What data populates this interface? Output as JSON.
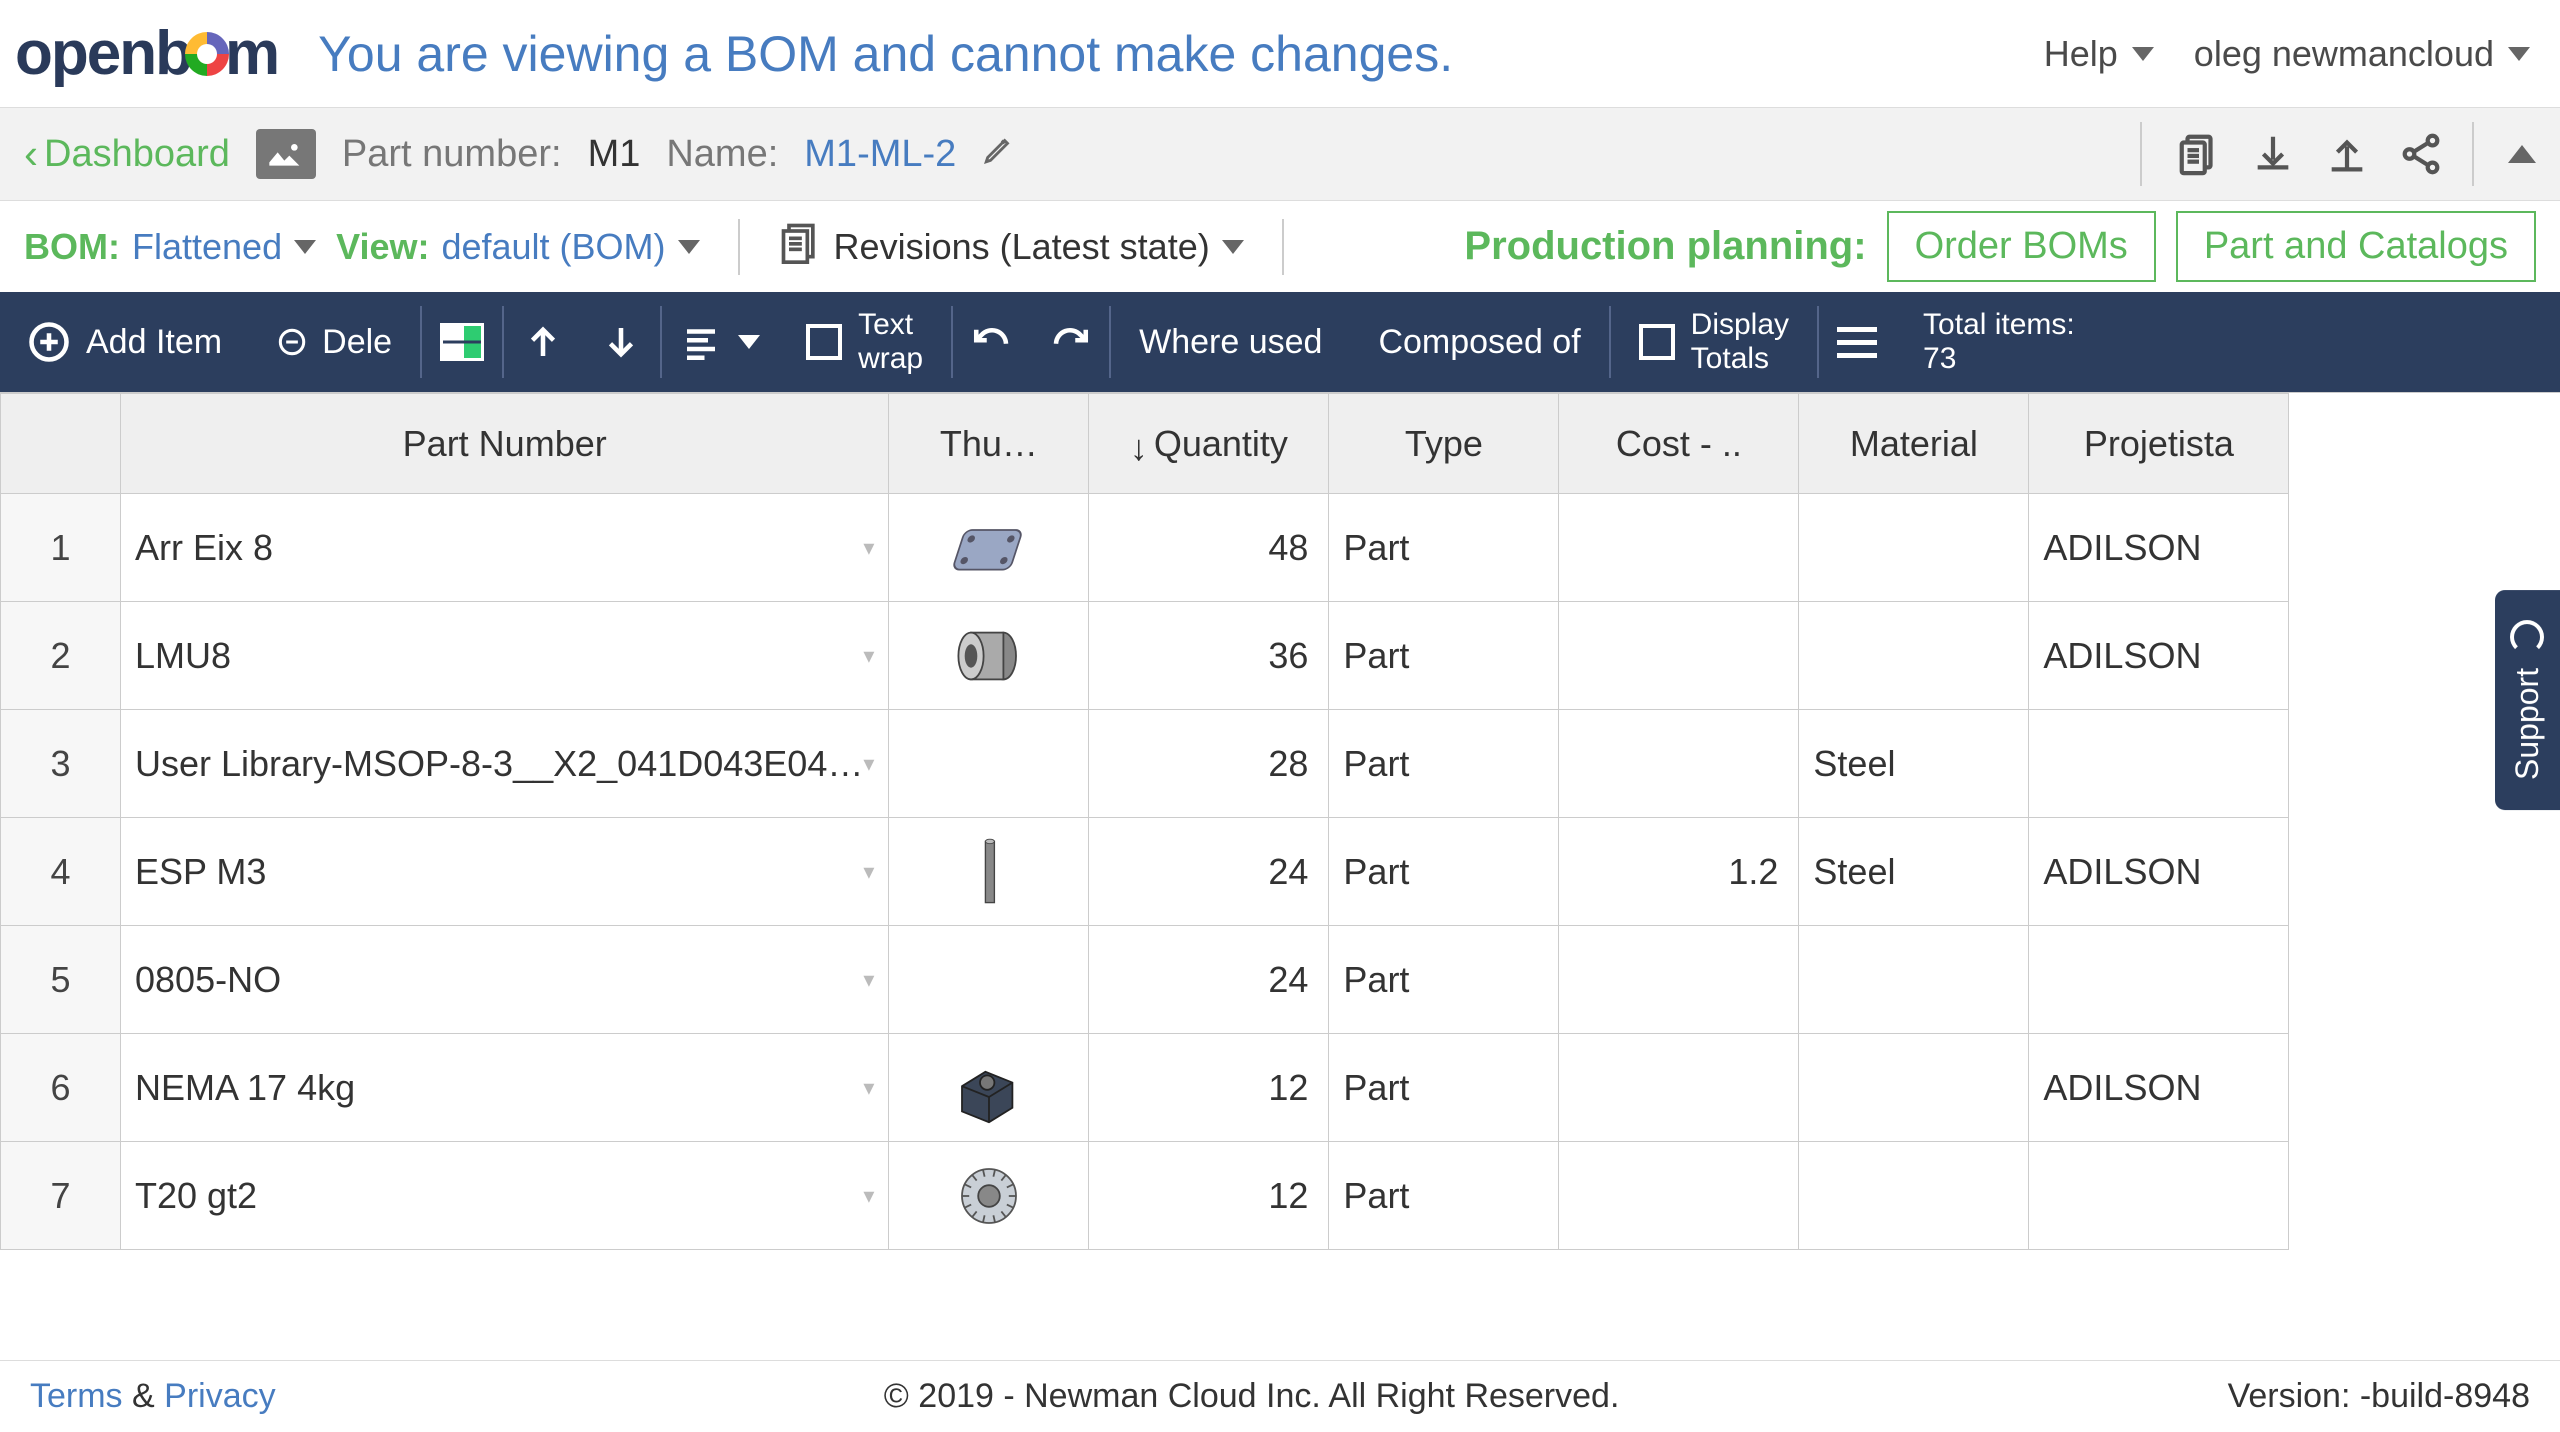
{
  "brand": {
    "name": "openbom"
  },
  "banner": "You are viewing a BOM and cannot make changes.",
  "top_right": {
    "help": "Help",
    "user": "oleg newmancloud"
  },
  "breadcrumb": {
    "back": "Dashboard",
    "part_number_label": "Part number:",
    "part_number": "M1",
    "name_label": "Name:",
    "name": "M1-ML-2"
  },
  "filter": {
    "bom_label": "BOM:",
    "bom_value": "Flattened",
    "view_label": "View:",
    "view_value": "default (BOM)",
    "revisions_label": "Revisions (Latest state)",
    "prod_label": "Production planning:",
    "order_boms": "Order BOMs",
    "part_catalogs": "Part and Catalogs"
  },
  "toolbar": {
    "add_item": "Add Item",
    "delete": "Dele",
    "text_wrap": "Text wrap",
    "where_used": "Where used",
    "composed_of": "Composed of",
    "display_totals": "Display Totals",
    "total_items_label": "Total items:",
    "total_items": "73"
  },
  "columns": [
    "",
    "Part Number",
    "Thu…",
    "Quantity",
    "Type",
    "Cost - ..",
    "Material",
    "Projetista"
  ],
  "rows": [
    {
      "n": 1,
      "pn": "Arr Eix 8",
      "thumb": "plate",
      "qty": 48,
      "type": "Part",
      "cost": "",
      "material": "",
      "proj": "ADILSON"
    },
    {
      "n": 2,
      "pn": "LMU8",
      "thumb": "bearing",
      "qty": 36,
      "type": "Part",
      "cost": "",
      "material": "",
      "proj": "ADILSON"
    },
    {
      "n": 3,
      "pn": "User Library-MSOP-8-3__X2_041D043E04…",
      "thumb": "",
      "qty": 28,
      "type": "Part",
      "cost": "",
      "material": "Steel",
      "proj": ""
    },
    {
      "n": 4,
      "pn": "ESP M3",
      "thumb": "rod",
      "qty": 24,
      "type": "Part",
      "cost": "1.2",
      "material": "Steel",
      "proj": "ADILSON"
    },
    {
      "n": 5,
      "pn": "0805-NO",
      "thumb": "",
      "qty": 24,
      "type": "Part",
      "cost": "",
      "material": "",
      "proj": ""
    },
    {
      "n": 6,
      "pn": "NEMA 17 4kg",
      "thumb": "motor",
      "qty": 12,
      "type": "Part",
      "cost": "",
      "material": "",
      "proj": "ADILSON"
    },
    {
      "n": 7,
      "pn": "T20 gt2",
      "thumb": "pulley",
      "qty": 12,
      "type": "Part",
      "cost": "",
      "material": "",
      "proj": ""
    }
  ],
  "footer": {
    "terms": "Terms",
    "amp": "&",
    "privacy": "Privacy",
    "copyright": "© 2019 - Newman Cloud Inc. All Right Reserved.",
    "version": "Version: -build-8948"
  },
  "support": "Support"
}
